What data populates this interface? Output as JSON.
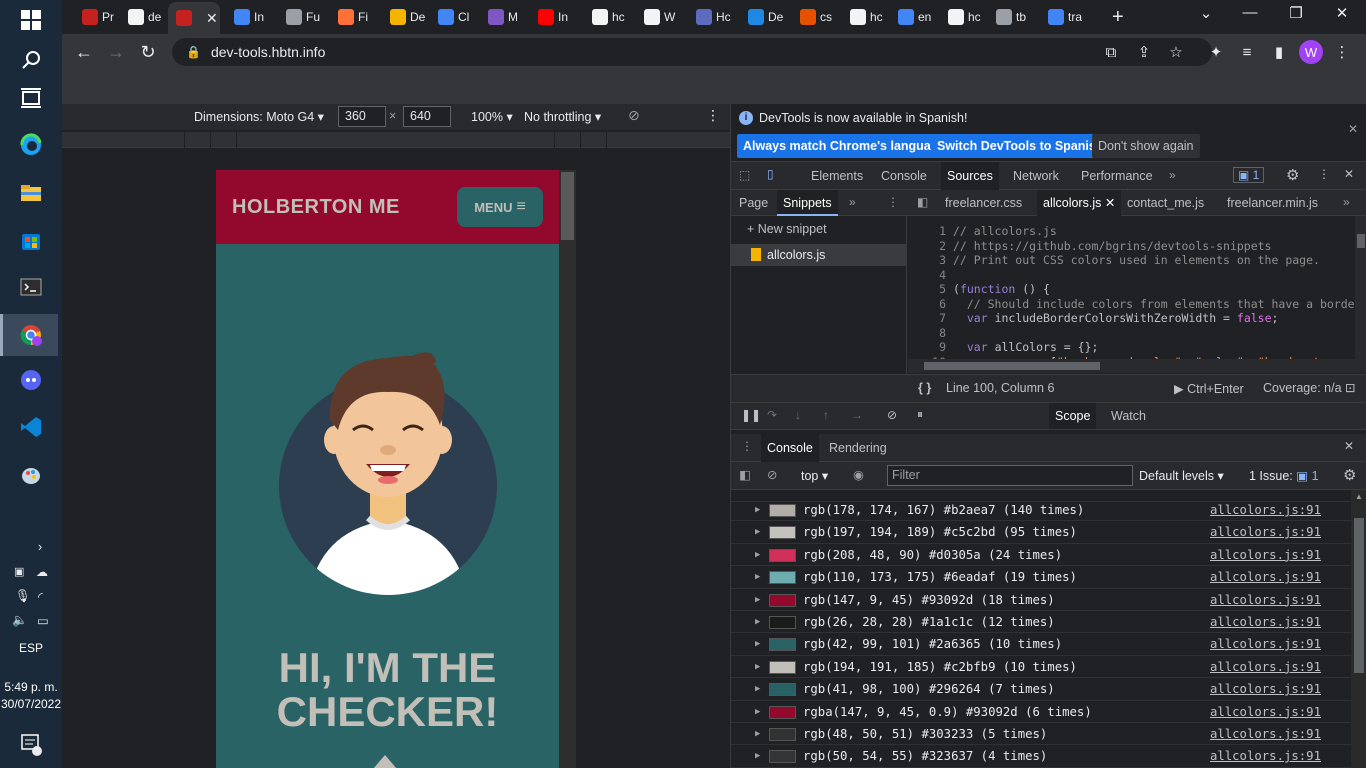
{
  "taskbar": {
    "clock_time": "5:49 p. m.",
    "clock_date": "30/07/2022",
    "language": "ESP",
    "notification_count": "1"
  },
  "tabs": [
    {
      "label": "Pr",
      "fav": "#c5221f"
    },
    {
      "label": "de",
      "fav": "#f1f3f4"
    },
    {
      "label": "",
      "fav": "#c5221f"
    },
    {
      "label": "In",
      "fav": "#4285f4"
    },
    {
      "label": "Fu",
      "fav": "#9aa0a6"
    },
    {
      "label": "Fi",
      "fav": "#ff7139"
    },
    {
      "label": "De",
      "fav": "#f4b400"
    },
    {
      "label": "Cl",
      "fav": "#4285f4"
    },
    {
      "label": "M",
      "fav": "#7e57c2"
    },
    {
      "label": "In",
      "fav": "#ff0000"
    },
    {
      "label": "hc",
      "fav": "#f1f3f4"
    },
    {
      "label": "W",
      "fav": "#f1f3f4"
    },
    {
      "label": "Hc",
      "fav": "#5c6bc0"
    },
    {
      "label": "De",
      "fav": "#1e88e5"
    },
    {
      "label": "cs",
      "fav": "#e65100"
    },
    {
      "label": "hc",
      "fav": "#f1f3f4"
    },
    {
      "label": "en",
      "fav": "#4285f4"
    },
    {
      "label": "hc",
      "fav": "#f1f3f4"
    },
    {
      "label": "tb",
      "fav": "#9aa0a6"
    },
    {
      "label": "tra",
      "fav": "#4285f4"
    }
  ],
  "address": {
    "url": "dev-tools.hbtn.info"
  },
  "profile_initial": "W",
  "device_toolbar": {
    "dimensions_label": "Dimensions: Moto G4",
    "width": "360",
    "height": "640",
    "times": "×",
    "zoom": "100%",
    "throttling": "No throttling"
  },
  "site": {
    "logo": "HOLBERTON ME",
    "menu_label": "MENU",
    "hero_title_line1": "HI, I'M THE",
    "hero_title_line2": "CHECKER!"
  },
  "devtools": {
    "infobar_text": "DevTools is now available in Spanish!",
    "btn_match": "Always match Chrome's language",
    "btn_switch": "Switch DevTools to Spanish",
    "btn_dismiss": "Don't show again",
    "main_tabs": [
      "Elements",
      "Console",
      "Sources",
      "Network",
      "Performance"
    ],
    "issues_count": "1",
    "nav_tabs": {
      "page": "Page",
      "snippets": "Snippets"
    },
    "file_tabs": [
      "freelancer.css",
      "allcolors.js",
      "contact_me.js",
      "freelancer.min.js"
    ],
    "new_snippet": "+ New snippet",
    "snippet_file": "allcolors.js",
    "code_lines": [
      {
        "n": "1",
        "html": "<span class='cm'>// allcolors.js</span>"
      },
      {
        "n": "2",
        "html": "<span class='cm'>// https://github.com/bgrins/devtools-snippets</span>"
      },
      {
        "n": "3",
        "html": "<span class='cm'>// Print out CSS colors used in elements on the page.</span>"
      },
      {
        "n": "4",
        "html": ""
      },
      {
        "n": "5",
        "html": "(<span class='kw'>function</span> () {"
      },
      {
        "n": "6",
        "html": "  <span class='cm'>// Should include colors from elements that have a border</span>"
      },
      {
        "n": "7",
        "html": "  <span class='kw'>var</span> includeBorderColorsWithZeroWidth = <span class='lit'>false</span>;"
      },
      {
        "n": "8",
        "html": ""
      },
      {
        "n": "9",
        "html": "  <span class='kw'>var</span> allColors = {};"
      },
      {
        "n": "10",
        "html": "  <span class='kw'>var</span> props = [<span class='str'>\"background-color\"</span>, <span class='str'>\"color\"</span>, <span class='str'>\"border-top-color\"</span>"
      }
    ],
    "status_position": "Line 100, Column 6",
    "status_run": "Ctrl+Enter",
    "status_coverage": "Coverage: n/a",
    "debug_tabs": {
      "scope": "Scope",
      "watch": "Watch"
    },
    "drawer_tabs": {
      "console": "Console",
      "rendering": "Rendering"
    },
    "console_context": "top",
    "filter_placeholder": "Filter",
    "levels": "Default levels",
    "issue_label": "1 Issue:",
    "issue_count": "1"
  },
  "console_rows": [
    {
      "color": "#b2aea7",
      "text": "rgb(178, 174, 167) #b2aea7 (140 times)",
      "link": "allcolors.js:91"
    },
    {
      "color": "#c5c2bd",
      "text": "rgb(197, 194, 189) #c5c2bd (95 times)",
      "link": "allcolors.js:91"
    },
    {
      "color": "#d0305a",
      "text": "rgb(208, 48, 90) #d0305a (24 times)",
      "link": "allcolors.js:91"
    },
    {
      "color": "#6eadaf",
      "text": "rgb(110, 173, 175) #6eadaf (19 times)",
      "link": "allcolors.js:91"
    },
    {
      "color": "#93092d",
      "text": "rgb(147, 9, 45) #93092d (18 times)",
      "link": "allcolors.js:91"
    },
    {
      "color": "#1a1c1c",
      "text": "rgb(26, 28, 28) #1a1c1c (12 times)",
      "link": "allcolors.js:91"
    },
    {
      "color": "#2a6365",
      "text": "rgb(42, 99, 101) #2a6365 (10 times)",
      "link": "allcolors.js:91"
    },
    {
      "color": "#c2bfb9",
      "text": "rgb(194, 191, 185) #c2bfb9 (10 times)",
      "link": "allcolors.js:91"
    },
    {
      "color": "#296264",
      "text": "rgb(41, 98, 100) #296264 (7 times)",
      "link": "allcolors.js:91"
    },
    {
      "color": "#93092d",
      "text": "rgba(147, 9, 45, 0.9) #93092d (6 times)",
      "link": "allcolors.js:91"
    },
    {
      "color": "#303233",
      "text": "rgb(48, 50, 51) #303233 (5 times)",
      "link": "allcolors.js:91"
    },
    {
      "color": "#323637",
      "text": "rgb(50, 54, 55) #323637 (4 times)",
      "link": "allcolors.js:91"
    }
  ]
}
